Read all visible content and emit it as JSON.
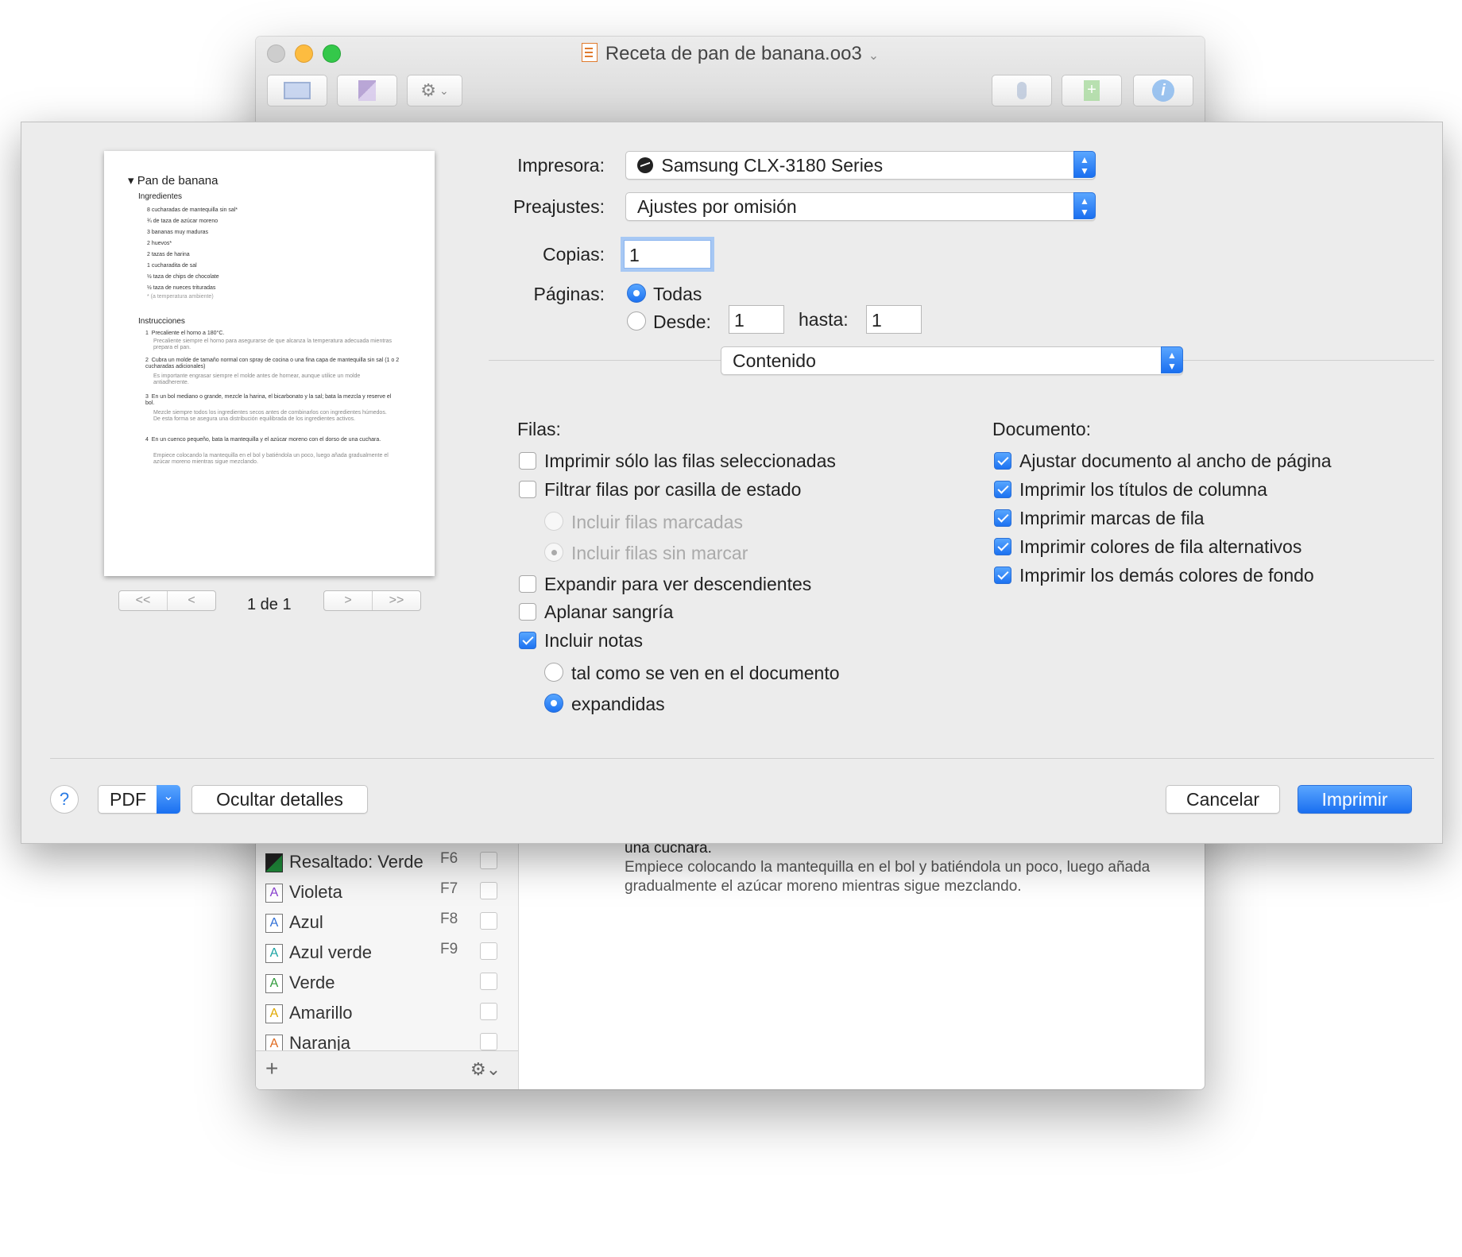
{
  "window": {
    "title": "Receta de pan de banana.oo3",
    "title_chevron": "⌄"
  },
  "toolbar": {
    "sidebar_icon": "sidebar-toggle-icon",
    "page_icon": "page-icon",
    "gear_icon": "⚙",
    "gear_chevron": "⌄",
    "mic_icon": "🎙",
    "add_icon": "+",
    "info_icon": "i"
  },
  "styles_sidebar": {
    "items": [
      {
        "label": "Resaltado: Verde",
        "key": "F6",
        "icon": "A",
        "color": "#1f8a3a",
        "highlight": true
      },
      {
        "label": "Violeta",
        "key": "F7",
        "icon": "A",
        "color": "#8a3fd1"
      },
      {
        "label": "Azul",
        "key": "F8",
        "icon": "A",
        "color": "#2f6fd6"
      },
      {
        "label": "Azul verde",
        "key": "F9",
        "icon": "A",
        "color": "#1aa3a3"
      },
      {
        "label": "Verde",
        "key": "",
        "icon": "A",
        "color": "#2f9a3a"
      },
      {
        "label": "Amarillo",
        "key": "",
        "icon": "A",
        "color": "#e0a800"
      },
      {
        "label": "Naranja",
        "key": "",
        "icon": "A",
        "color": "#e06a1e"
      }
    ],
    "add_label": "+",
    "gear_label": "⚙⌄"
  },
  "document_content": {
    "line_bold": "una cuchara.",
    "note": "Empiece colocando la mantequilla en el bol y batiéndola un poco, luego añada gradualmente el azúcar moreno mientras sigue mezclando."
  },
  "print_dialog": {
    "preview": {
      "title": "▾ Pan de banana",
      "ingredients_heading": "Ingredientes",
      "ingredients": [
        "8 cucharadas de mantequilla sin sal*",
        "¾ de taza de azúcar moreno",
        "3 bananas muy maduras",
        "2 huevos*",
        "2 tazas de harina",
        "1 cucharadita de sal",
        "½ taza de chips de chocolate",
        "½ taza de nueces trituradas"
      ],
      "ingredients_note": "* (a temperatura ambiente)",
      "instructions_heading": "Instrucciones",
      "steps": [
        {
          "n": "1",
          "text": "Precaliente el horno a 180°C.",
          "note": "Precaliente siempre el horno para asegurarse de que alcanza la temperatura adecuada mientras prepara el pan."
        },
        {
          "n": "2",
          "text": "Cubra un molde de tamaño normal con spray de cocina o una fina capa de mantequilla sin sal (1 o 2 cucharadas adicionales)",
          "note": "Es importante engrasar siempre el molde antes de hornear, aunque utilice un molde antiadherente."
        },
        {
          "n": "3",
          "text": "En un bol mediano o grande, mezcle la harina, el bicarbonato y la sal; bata la mezcla y reserve el bol.",
          "note": "Mezcle siempre todos los ingredientes secos antes de combinarlos con ingredientes húmedos. De esta forma se asegura una distribución equilibrada de los ingredientes activos."
        },
        {
          "n": "4",
          "text": "En un cuenco pequeño, bata la mantequilla y el azúcar moreno con el dorso de una cuchara.",
          "note": "Empiece colocando la mantequilla en el bol y batiéndola un poco, luego añada gradualmente el azúcar moreno mientras sigue mezclando."
        }
      ],
      "nav_first": "<<",
      "nav_prev": "<",
      "nav_next": ">",
      "nav_last": ">>",
      "page_count": "1 de 1"
    },
    "printer_label": "Impresora:",
    "printer_value": "Samsung CLX-3180 Series",
    "presets_label": "Preajustes:",
    "presets_value": "Ajustes por omisión",
    "copies_label": "Copias:",
    "copies_value": "1",
    "pages_label": "Páginas:",
    "pages_all": "Todas",
    "pages_from": "Desde:",
    "pages_from_value": "1",
    "pages_to": "hasta:",
    "pages_to_value": "1",
    "section_popup": "Contenido",
    "rows_heading": "Filas:",
    "rows_options": [
      {
        "label": "Imprimir sólo las filas seleccionadas",
        "checked": false
      },
      {
        "label": "Filtrar filas por casilla de estado",
        "checked": false
      },
      {
        "label": "Incluir filas marcadas",
        "checked": false,
        "disabled": true
      },
      {
        "label": "Incluir filas sin marcar",
        "checked": true,
        "disabled": true
      },
      {
        "label": "Expandir para ver descendientes",
        "checked": false
      },
      {
        "label": "Aplanar sangría",
        "checked": false
      },
      {
        "label": "Incluir notas",
        "checked": true
      },
      {
        "label": "tal como se ven en el documento",
        "checked": false
      },
      {
        "label": "expandidas",
        "checked": true
      }
    ],
    "document_heading": "Documento:",
    "document_options": [
      {
        "label": "Ajustar documento al ancho de página",
        "checked": true
      },
      {
        "label": "Imprimir los títulos de columna",
        "checked": true
      },
      {
        "label": "Imprimir marcas de fila",
        "checked": true
      },
      {
        "label": "Imprimir colores de fila alternativos",
        "checked": true
      },
      {
        "label": "Imprimir los demás colores de fondo",
        "checked": true
      }
    ],
    "help_label": "?",
    "pdf_label": "PDF",
    "pdf_chevron": "⌄",
    "hide_details_label": "Ocultar detalles",
    "cancel_label": "Cancelar",
    "print_label": "Imprimir",
    "accent_color": "#1d72f1"
  }
}
